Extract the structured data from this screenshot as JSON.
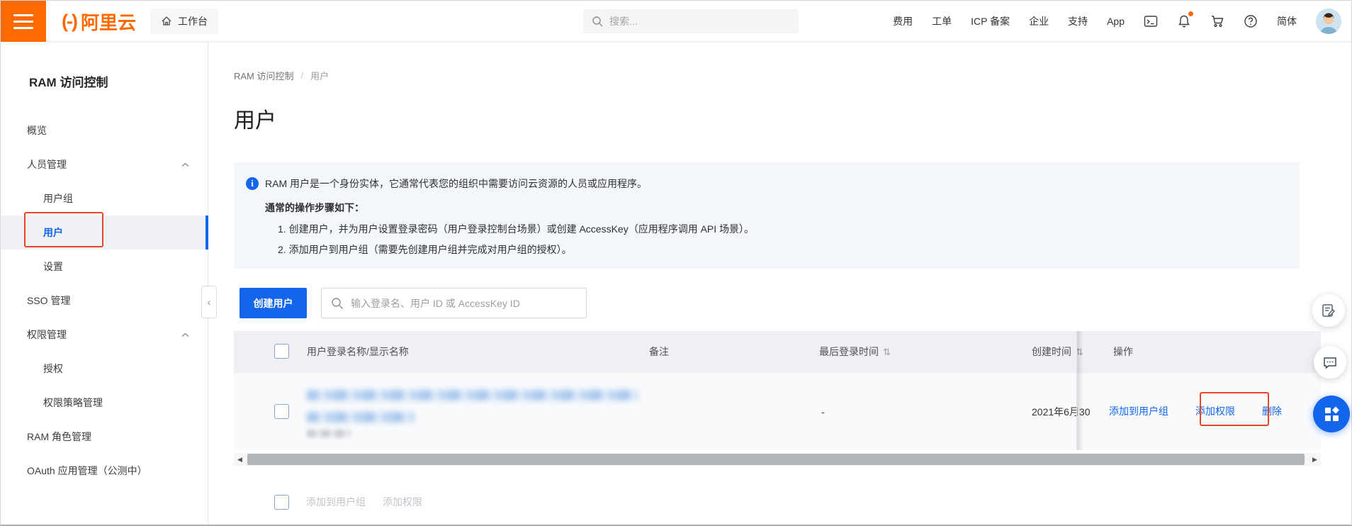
{
  "navbar": {
    "brand": "阿里云",
    "workbench": "工作台",
    "search_placeholder": "搜索...",
    "links": [
      "费用",
      "工单",
      "ICP 备案",
      "企业",
      "支持",
      "App"
    ],
    "locale": "简体",
    "icons": [
      "terminal-icon",
      "bell-icon",
      "cart-icon",
      "help-icon"
    ]
  },
  "sidebar": {
    "title": "RAM 访问控制",
    "items": [
      {
        "label": "概览",
        "level": 1
      },
      {
        "label": "人员管理",
        "level": 1,
        "group": true,
        "expanded": true
      },
      {
        "label": "用户组",
        "level": 2
      },
      {
        "label": "用户",
        "level": 2,
        "selected": true
      },
      {
        "label": "设置",
        "level": 2
      },
      {
        "label": "SSO 管理",
        "level": 1
      },
      {
        "label": "权限管理",
        "level": 1,
        "group": true,
        "expanded": true
      },
      {
        "label": "授权",
        "level": 2
      },
      {
        "label": "权限策略管理",
        "level": 2
      },
      {
        "label": "RAM 角色管理",
        "level": 1
      },
      {
        "label": "OAuth 应用管理（公测中）",
        "level": 1
      }
    ]
  },
  "breadcrumb": {
    "root": "RAM 访问控制",
    "current": "用户"
  },
  "page": {
    "title": "用户"
  },
  "info_banner": {
    "line1": "RAM 用户是一个身份实体，它通常代表您的组织中需要访问云资源的人员或应用程序。",
    "steps_title": "通常的操作步骤如下：",
    "steps": [
      "1. 创建用户，并为用户设置登录密码（用户登录控制台场景）或创建 AccessKey（应用程序调用 API 场景）。",
      "2. 添加用户到用户组（需要先创建用户组并完成对用户组的授权）。"
    ]
  },
  "toolbar": {
    "create_button": "创建用户",
    "search_placeholder": "输入登录名、用户 ID 或 AccessKey ID"
  },
  "table": {
    "headers": [
      "用户登录名称/显示名称",
      "备注",
      "最后登录时间",
      "创建时间",
      "操作"
    ],
    "row": {
      "login_name_redacted": true,
      "remark": "",
      "last_login": "-",
      "created": "2021年6月30",
      "actions": [
        "添加到用户组",
        "添加权限",
        "删除"
      ]
    }
  },
  "batch_actions": [
    "添加到用户组",
    "添加权限"
  ],
  "colors": {
    "brand_orange": "#FF6A00",
    "primary_blue": "#1366EC",
    "annotation_red": "#E5472D",
    "banner_bg": "#f3f6fa"
  }
}
